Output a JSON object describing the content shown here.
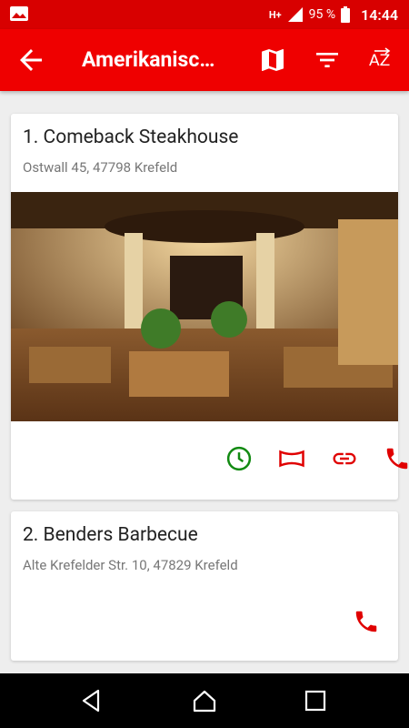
{
  "status_bar": {
    "network": "H+",
    "battery_percent": "95 %",
    "time": "14:44",
    "icons": [
      "image-icon",
      "network-signal-icon",
      "battery-icon"
    ]
  },
  "app_bar": {
    "title": "Amerikanisc…",
    "actions": [
      "back-arrow-icon",
      "map-icon",
      "filter-icon",
      "sort-az-icon"
    ]
  },
  "restaurants": [
    {
      "name": "1. Comeback Steakhouse",
      "address": "Ostwall 45, 47798 Krefeld",
      "has_photo": true,
      "actions": [
        "opening-hours-icon",
        "menu-icon",
        "link-icon",
        "phone-icon"
      ]
    },
    {
      "name": "2. Benders Barbecue",
      "address": "Alte Krefelder Str. 10, 47829 Krefeld",
      "has_photo": false,
      "actions": [
        "phone-icon"
      ]
    }
  ],
  "colors": {
    "status_bar": "#d80000",
    "app_bar": "#ef0000",
    "action_red": "#e00000",
    "open_green": "#128a12"
  },
  "nav_bar": [
    "back-triangle-icon",
    "home-icon",
    "recents-icon"
  ]
}
